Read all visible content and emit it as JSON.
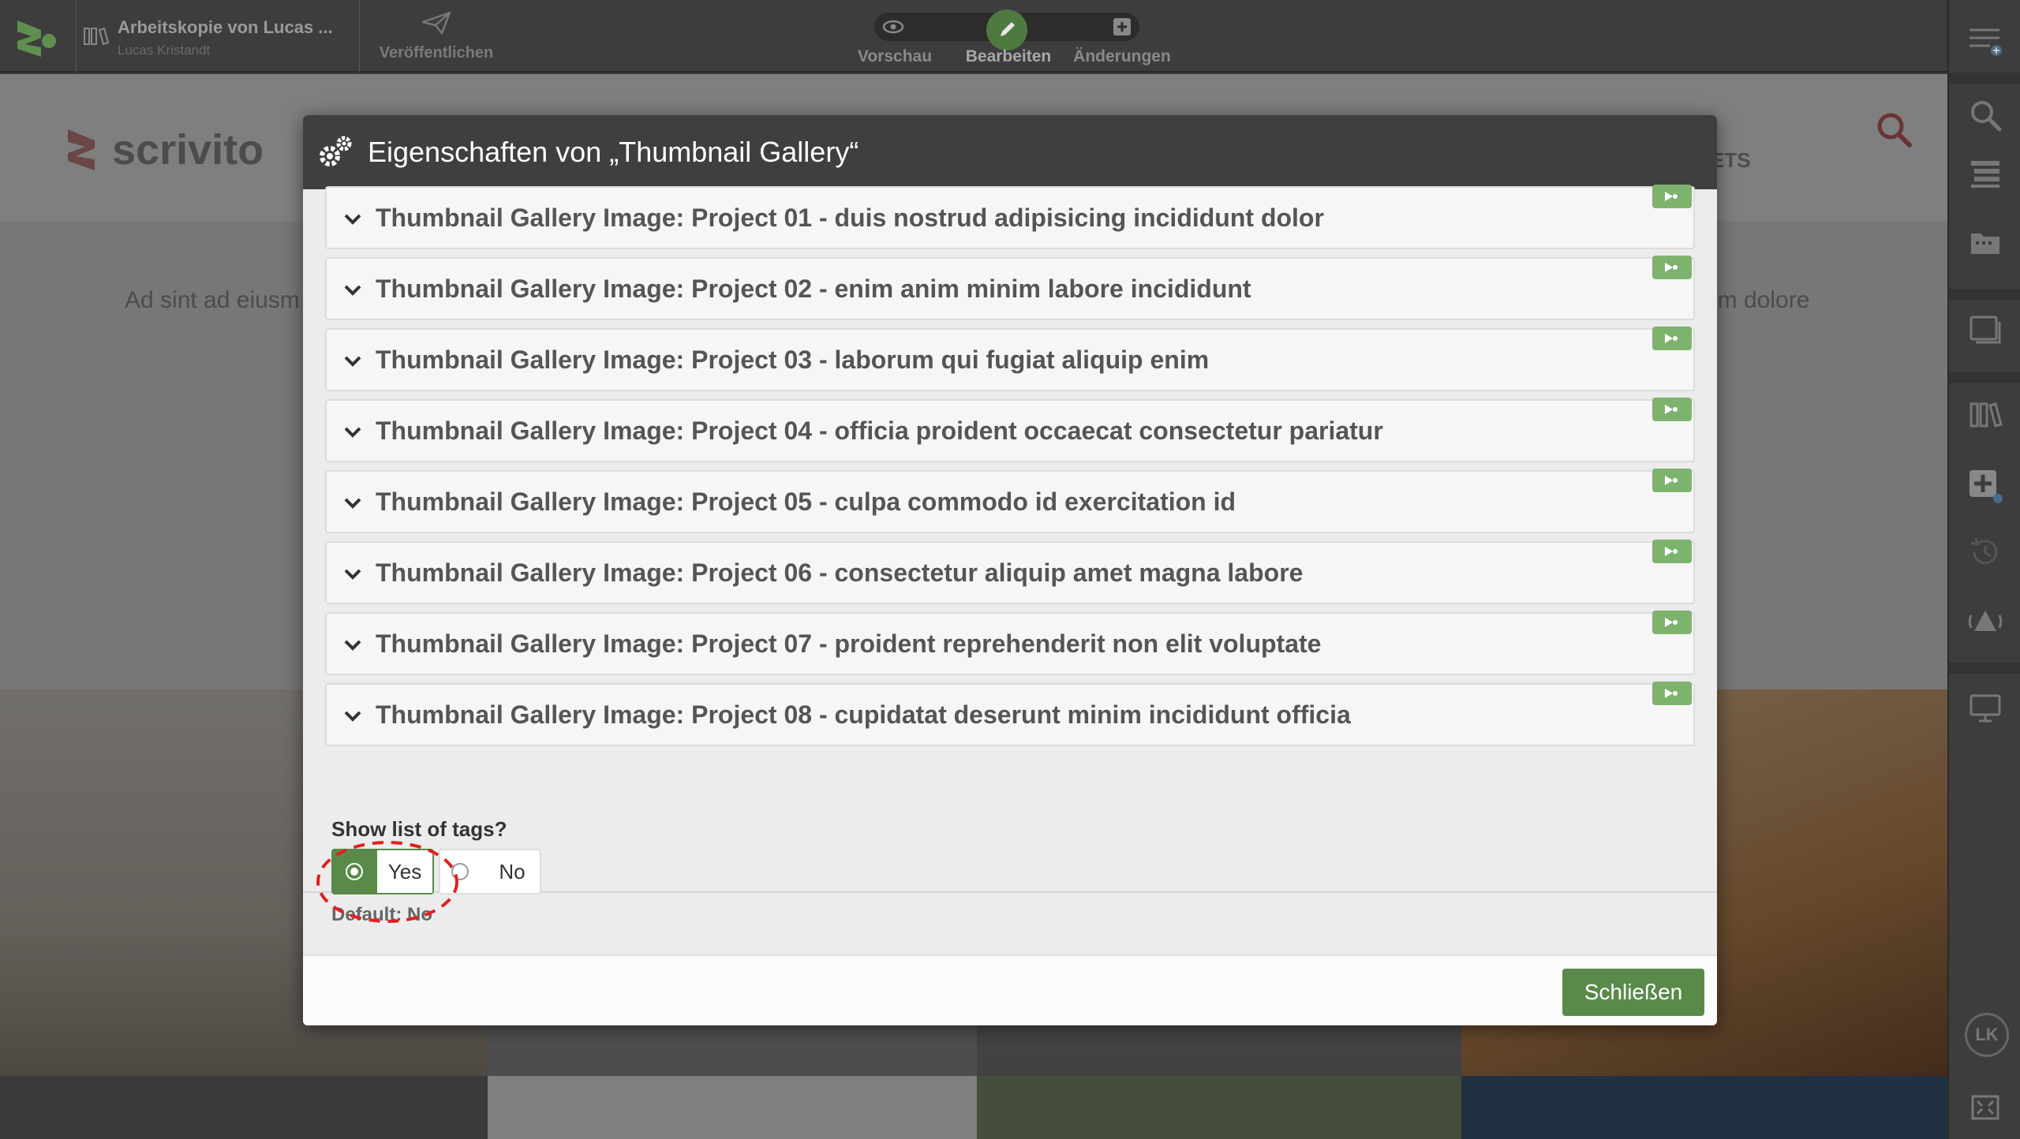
{
  "toolbar": {
    "workspace_title": "Arbeitskopie von Lucas ...",
    "workspace_owner": "Lucas Kristandt",
    "publish_label": "Veröffentlichen",
    "modes": [
      {
        "label": "Vorschau",
        "icon": "eye-icon"
      },
      {
        "label": "Bearbeiten",
        "icon": "pencil-icon",
        "active": true
      },
      {
        "label": "Änderungen",
        "icon": "plus-square-icon"
      }
    ]
  },
  "sidebar": {
    "items": [
      "menu-plus-icon",
      "search-icon",
      "list-icon",
      "folder-icon",
      "window-icon",
      "library-icon",
      "add-widget-icon",
      "history-icon",
      "alert-icon",
      "monitor-icon",
      "fullscreen-icon"
    ],
    "avatar_initials": "LK"
  },
  "page": {
    "logo_text": "scrivito",
    "nav_fragment": "ETS",
    "text_left": "Ad sint ad eiusm",
    "text_right": "im dolore"
  },
  "modal": {
    "title": "Eigenschaften von „Thumbnail Gallery“",
    "items": [
      {
        "label": "Thumbnail Gallery Image: Project 01 - duis nostrud adipisicing incididunt dolor"
      },
      {
        "label": "Thumbnail Gallery Image: Project 02 - enim anim minim labore incididunt"
      },
      {
        "label": "Thumbnail Gallery Image: Project 03 - laborum qui fugiat aliquip enim"
      },
      {
        "label": "Thumbnail Gallery Image: Project 04 - officia proident occaecat consectetur pariatur"
      },
      {
        "label": "Thumbnail Gallery Image: Project 05 - culpa commodo id exercitation id"
      },
      {
        "label": "Thumbnail Gallery Image: Project 06 - consectetur aliquip amet magna labore"
      },
      {
        "label": "Thumbnail Gallery Image: Project 07 - proident reprehenderit non elit voluptate"
      },
      {
        "label": "Thumbnail Gallery Image: Project 08 - cupidatat deserunt minim incididunt officia"
      }
    ],
    "tags_field": {
      "label": "Show list of tags?",
      "options": [
        "Yes",
        "No"
      ],
      "selected": "Yes",
      "default_text": "Default: No"
    },
    "close_label": "Schließen"
  },
  "colors": {
    "accent_green": "#5a8a4a",
    "tag_green": "#7db36d",
    "toolbar_bg": "#3d3d3d",
    "modal_header": "#3f3f3f",
    "callout_red": "#e02020"
  }
}
